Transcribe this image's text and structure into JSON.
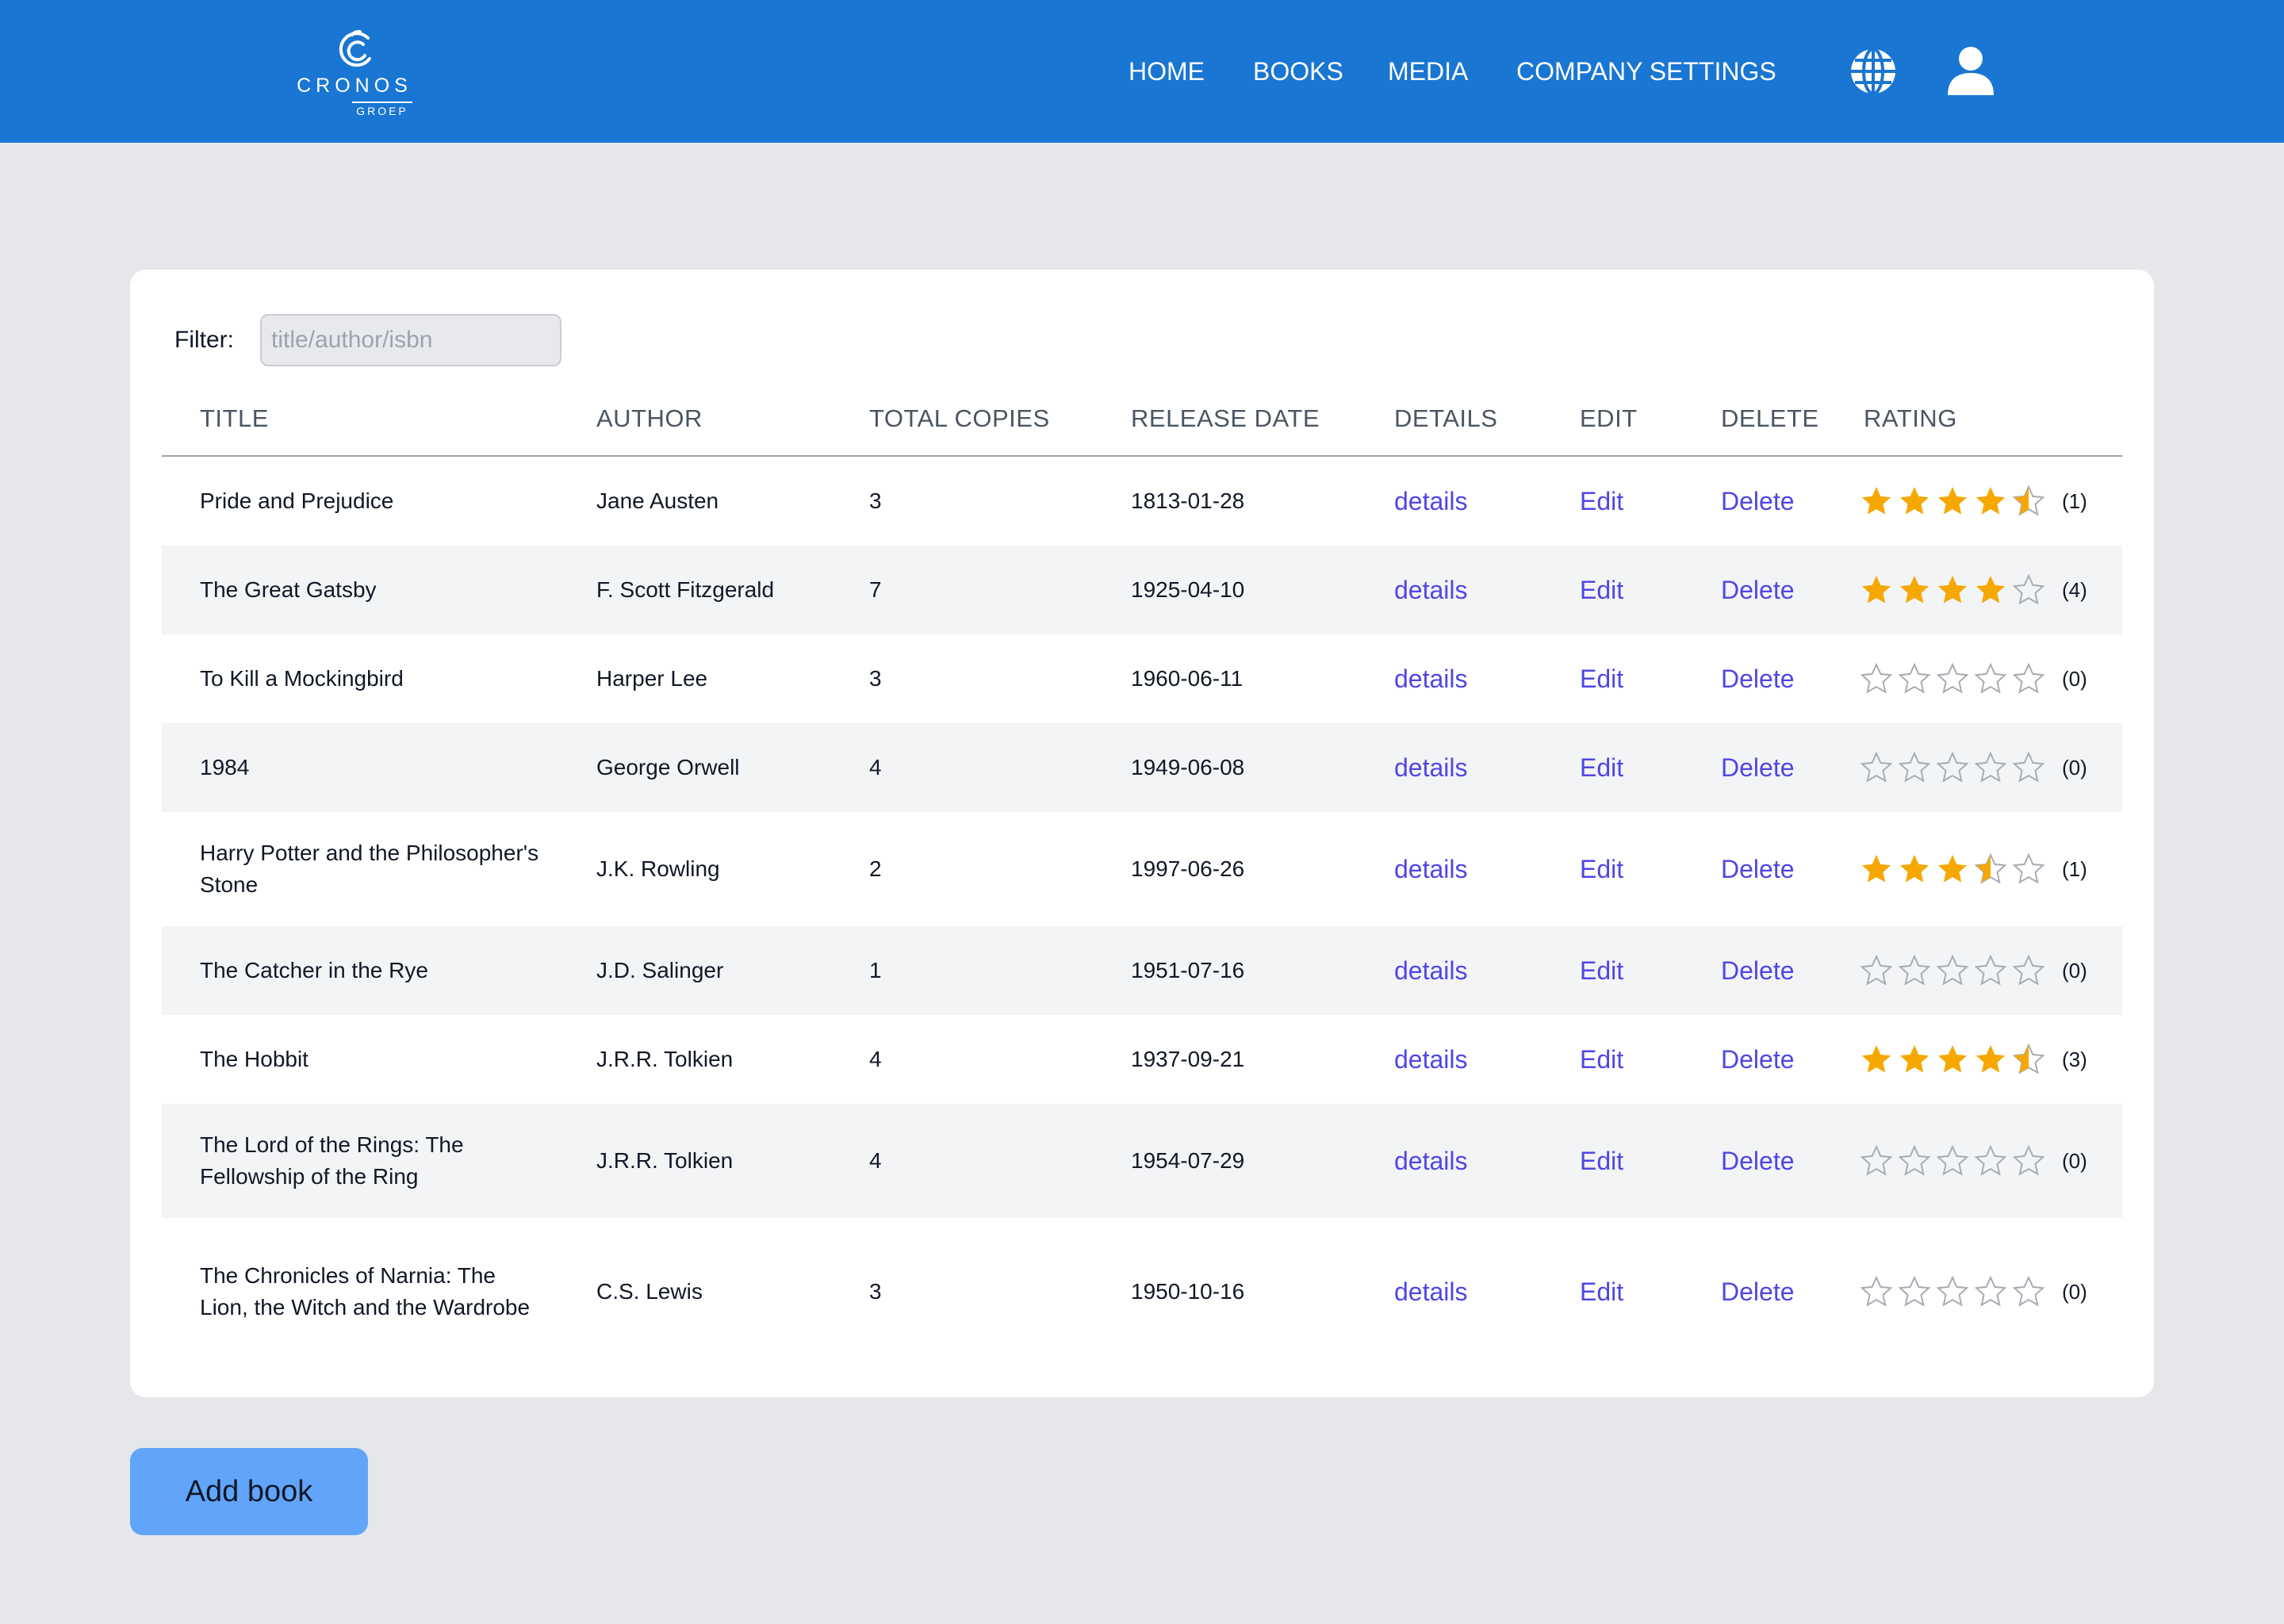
{
  "brand": {
    "name": "CRONOS",
    "sub": "GROEP"
  },
  "nav": [
    {
      "label": "HOME",
      "slug": "home"
    },
    {
      "label": "BOOKS",
      "slug": "books"
    },
    {
      "label": "MEDIA",
      "slug": "media"
    },
    {
      "label": "COMPANY SETTINGS",
      "slug": "company-settings"
    }
  ],
  "icons": {
    "language": "globe-icon",
    "account": "user-icon"
  },
  "filter": {
    "label": "Filter:",
    "placeholder": "title/author/isbn",
    "value": ""
  },
  "table": {
    "headers": {
      "title": "TITLE",
      "author": "AUTHOR",
      "copies": "TOTAL COPIES",
      "release": "RELEASE DATE",
      "details": "DETAILS",
      "edit": "EDIT",
      "delete": "DELETE",
      "rating": "RATING"
    },
    "link_labels": {
      "details": "details",
      "edit": "Edit",
      "delete": "Delete"
    },
    "rows": [
      {
        "title": "Pride and Prejudice",
        "author": "Jane Austen",
        "copies": "3",
        "release": "1813-01-28",
        "rating": 4.5,
        "count": "(1)"
      },
      {
        "title": "The Great Gatsby",
        "author": "F. Scott Fitzgerald",
        "copies": "7",
        "release": "1925-04-10",
        "rating": 4,
        "count": "(4)"
      },
      {
        "title": "To Kill a Mockingbird",
        "author": "Harper Lee",
        "copies": "3",
        "release": "1960-06-11",
        "rating": 0,
        "count": "(0)"
      },
      {
        "title": "1984",
        "author": "George Orwell",
        "copies": "4",
        "release": "1949-06-08",
        "rating": 0,
        "count": "(0)"
      },
      {
        "title": "Harry Potter and the Philosopher's Stone",
        "author": "J.K. Rowling",
        "copies": "2",
        "release": "1997-06-26",
        "rating": 3.5,
        "count": "(1)"
      },
      {
        "title": "The Catcher in the Rye",
        "author": "J.D. Salinger",
        "copies": "1",
        "release": "1951-07-16",
        "rating": 0,
        "count": "(0)"
      },
      {
        "title": "The Hobbit",
        "author": "J.R.R. Tolkien",
        "copies": "4",
        "release": "1937-09-21",
        "rating": 4.5,
        "count": "(3)"
      },
      {
        "title": "The Lord of the Rings: The Fellowship of the Ring",
        "author": "J.R.R. Tolkien",
        "copies": "4",
        "release": "1954-07-29",
        "rating": 0,
        "count": "(0)"
      },
      {
        "title": "The Chronicles of Narnia: The Lion, the Witch and the Wardrobe",
        "author": "C.S. Lewis",
        "copies": "3",
        "release": "1950-10-16",
        "rating": 0,
        "count": "(0)"
      }
    ]
  },
  "actions": {
    "add_book": "Add book"
  },
  "colors": {
    "header": "#1976d2",
    "background": "#e5e7eb",
    "link": "#4f46e5",
    "star_filled": "#f6a800",
    "star_empty": "#a8acb3",
    "add_button": "#60a5fa"
  }
}
